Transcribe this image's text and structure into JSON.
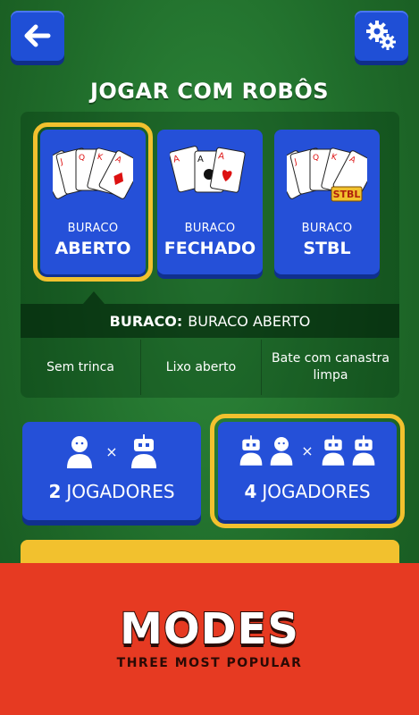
{
  "header": {
    "title": "JOGAR COM ROBÔS"
  },
  "modes": [
    {
      "small": "BURACO",
      "big": "ABERTO",
      "selected": true
    },
    {
      "small": "BURACO",
      "big": "FECHADO",
      "selected": false
    },
    {
      "small": "BURACO",
      "big": "STBL",
      "selected": false,
      "badge": "STBL"
    }
  ],
  "description": {
    "prefix": "BURACO:",
    "text": "BURACO ABERTO"
  },
  "rules": [
    "Sem trinca",
    "Lixo aberto",
    "Bate com canastra limpa"
  ],
  "players": [
    {
      "count": "2",
      "label": "JOGADORES",
      "selected": false
    },
    {
      "count": "4",
      "label": "JOGADORES",
      "selected": true
    }
  ],
  "cards": {
    "ranks": [
      "10",
      "J",
      "Q",
      "K",
      "A"
    ],
    "ace": "A",
    "vs": "×"
  },
  "banner": {
    "headline": "MODES",
    "subtitle": "THREE MOST POPULAR"
  },
  "colors": {
    "accent": "#f2c12e",
    "button": "#2550d8",
    "banner": "#e63a22",
    "felt": "#1f6b2a"
  }
}
